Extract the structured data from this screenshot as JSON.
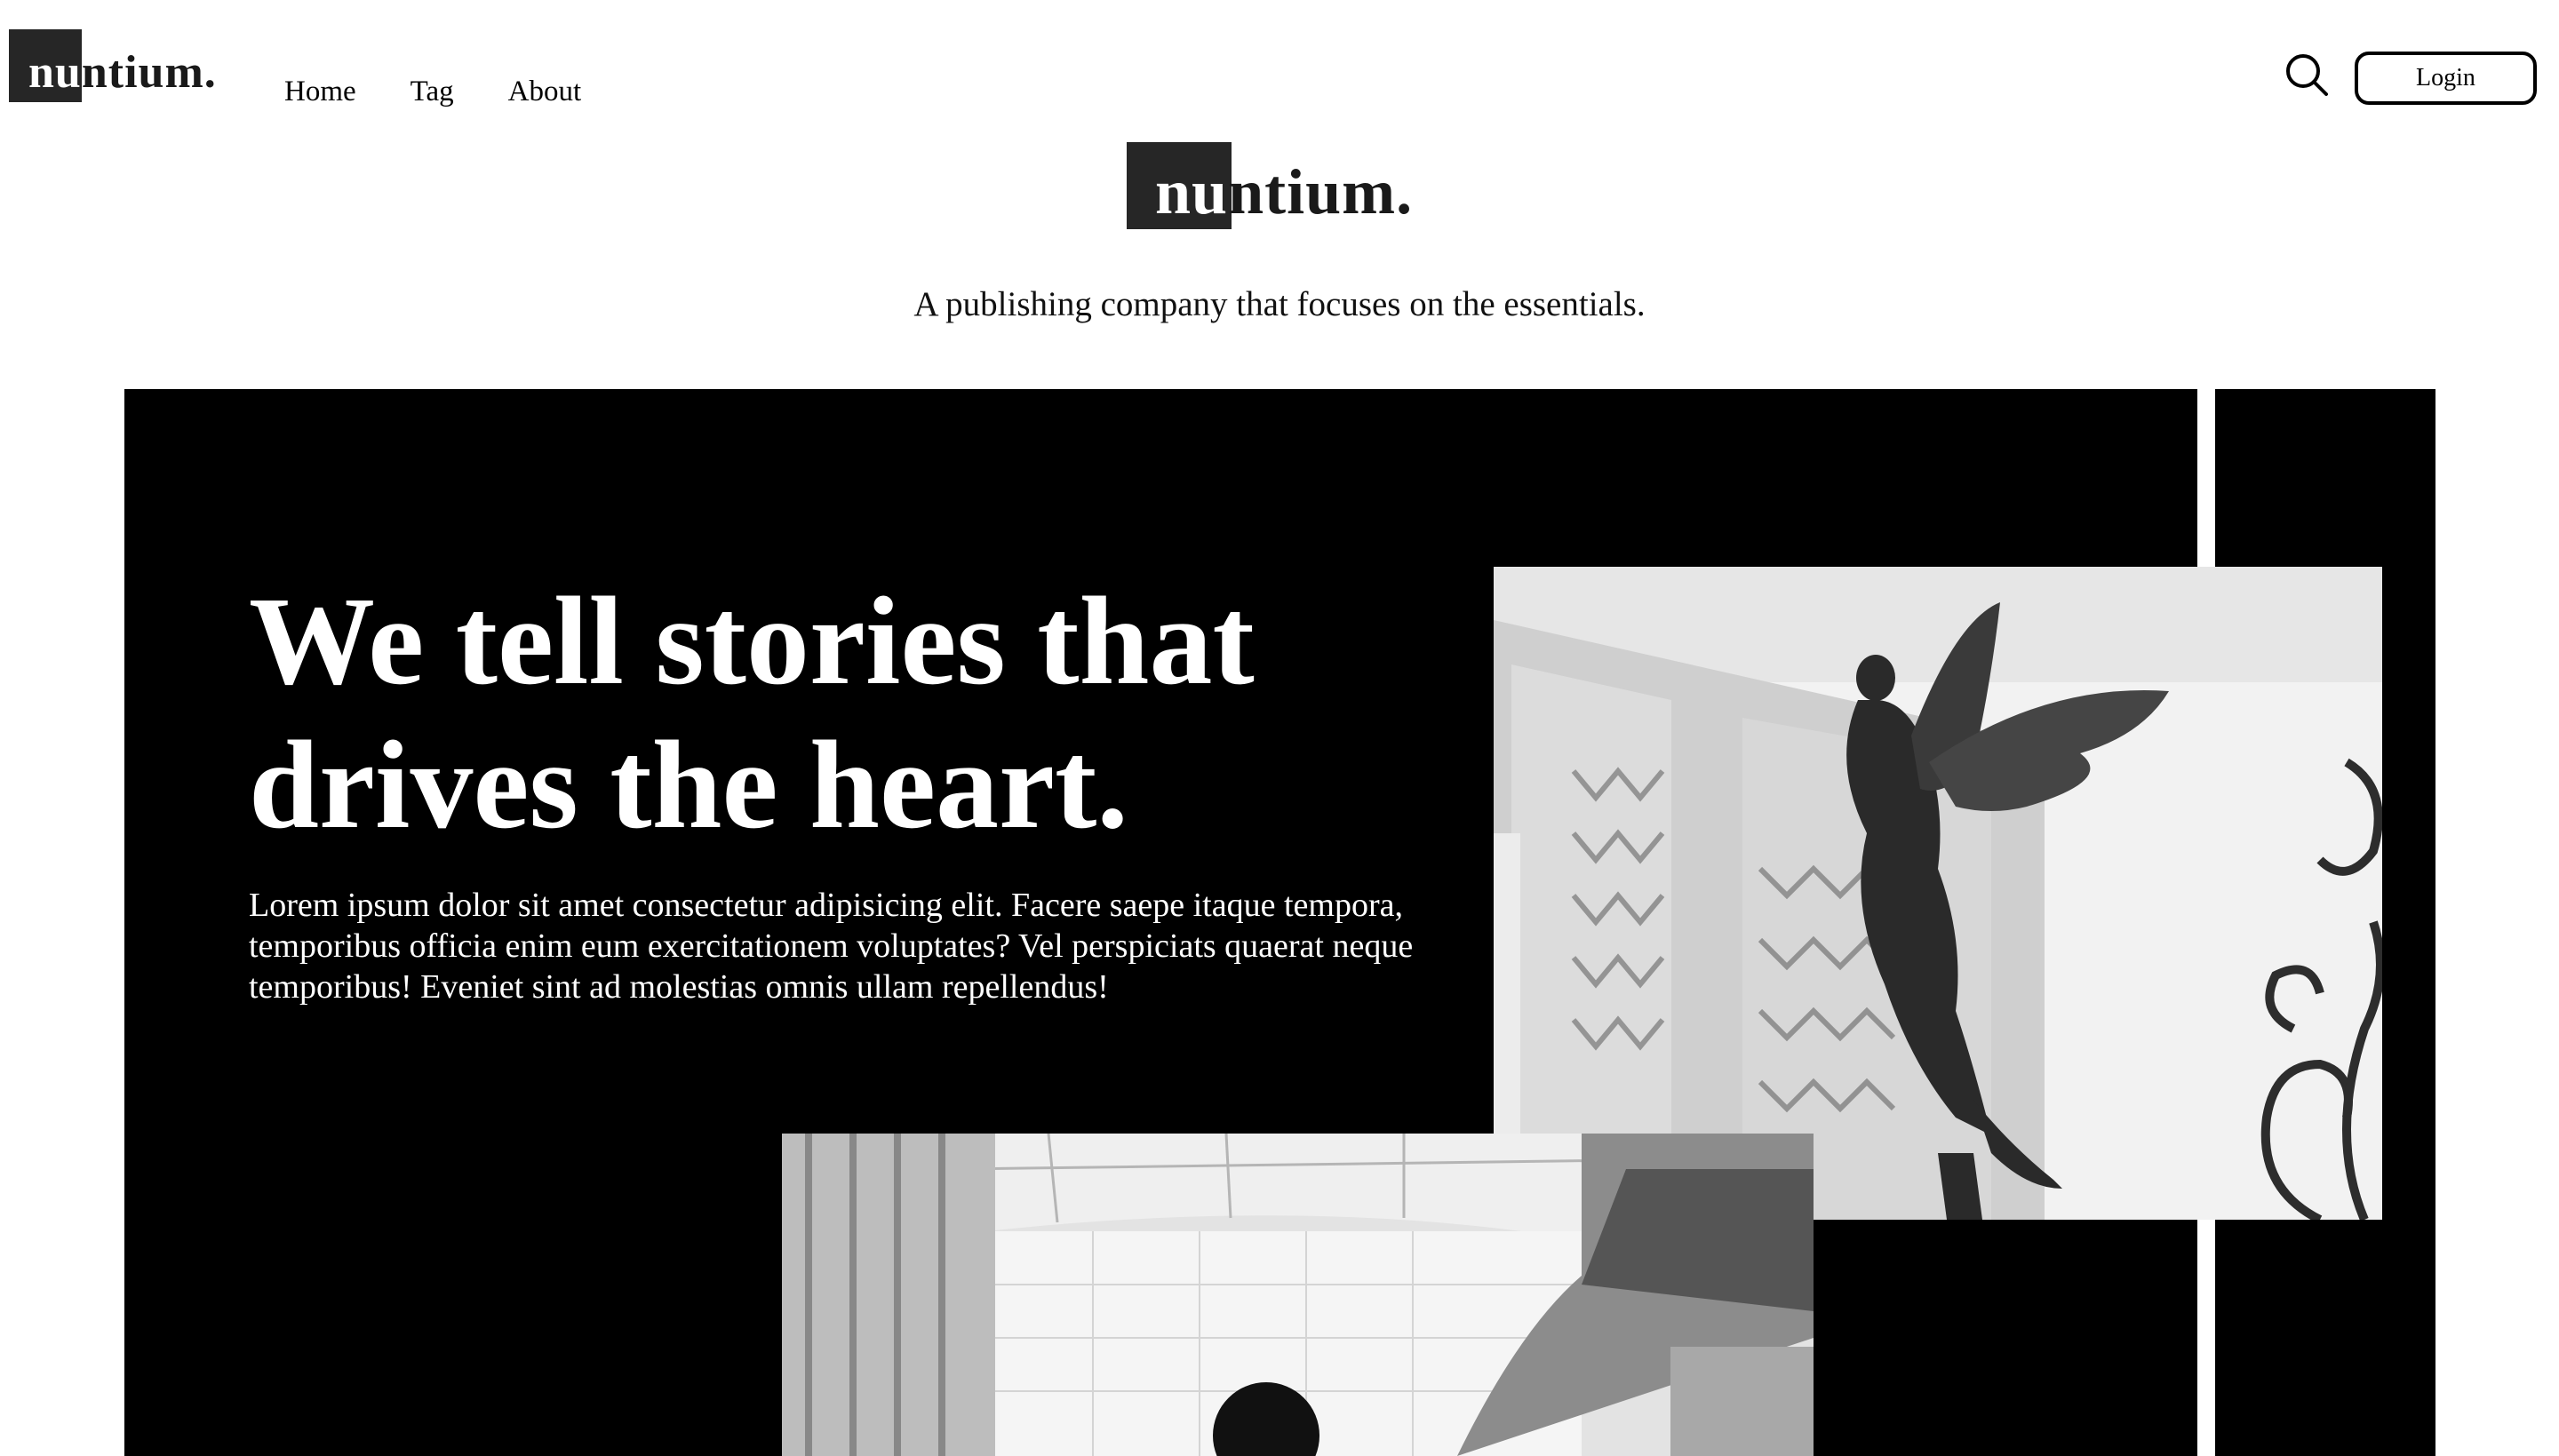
{
  "brand": {
    "name_prefix": "nu",
    "name_suffix": "ntium.",
    "tagline": "A publishing company that focuses on the essentials."
  },
  "nav": {
    "items": [
      {
        "label": "Home"
      },
      {
        "label": "Tag"
      },
      {
        "label": "About"
      }
    ],
    "search_icon": "search-icon",
    "login_label": "Login"
  },
  "hero": {
    "title": "We tell stories that drives the heart.",
    "body": "Lorem ipsum dolor sit amet consectetur adipisicing elit. Facere saepe itaque tempora, temporibus officia enim eum exercitationem voluptates? Vel perspiciats quaerat neque temporibus! Eveniet sint ad molestias omnis ullam repellendus!",
    "images": [
      {
        "subject": "angel statue with wings next to a building and wrought-iron scrollwork"
      },
      {
        "subject": "person in a bright interior hall with ceiling and windows"
      }
    ]
  },
  "colors": {
    "background": "#ffffff",
    "hero_background": "#000000",
    "hero_text": "#ffffff",
    "logo_block": "#262626",
    "text": "#000000"
  }
}
